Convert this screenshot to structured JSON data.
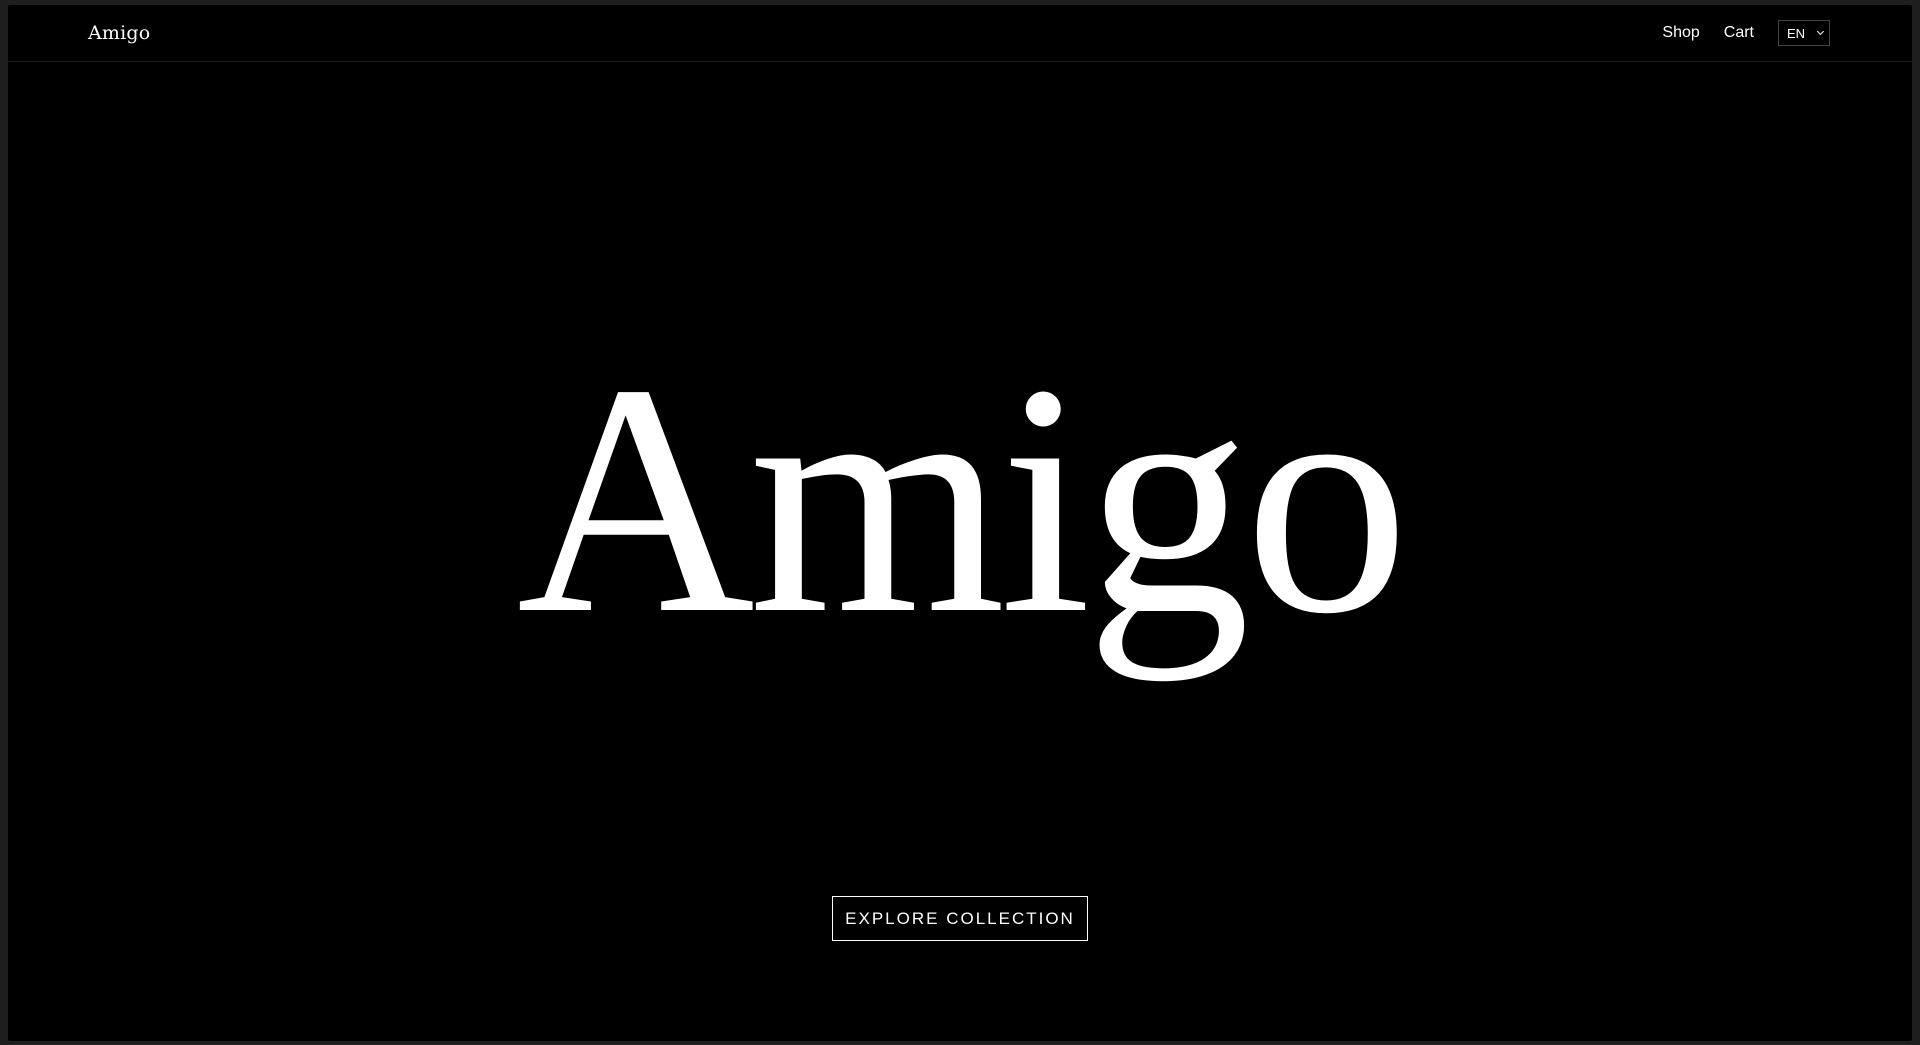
{
  "header": {
    "logo": "Amigo",
    "nav": {
      "shop": "Shop",
      "cart": "Cart"
    },
    "language": {
      "selected": "EN",
      "icon": "chevron-down-icon"
    }
  },
  "hero": {
    "title": "Amigo",
    "cta_label": "EXPLORE COLLECTION"
  },
  "colors": {
    "background": "#000000",
    "text": "#ffffff",
    "outer_frame": "#1e1e1e"
  }
}
